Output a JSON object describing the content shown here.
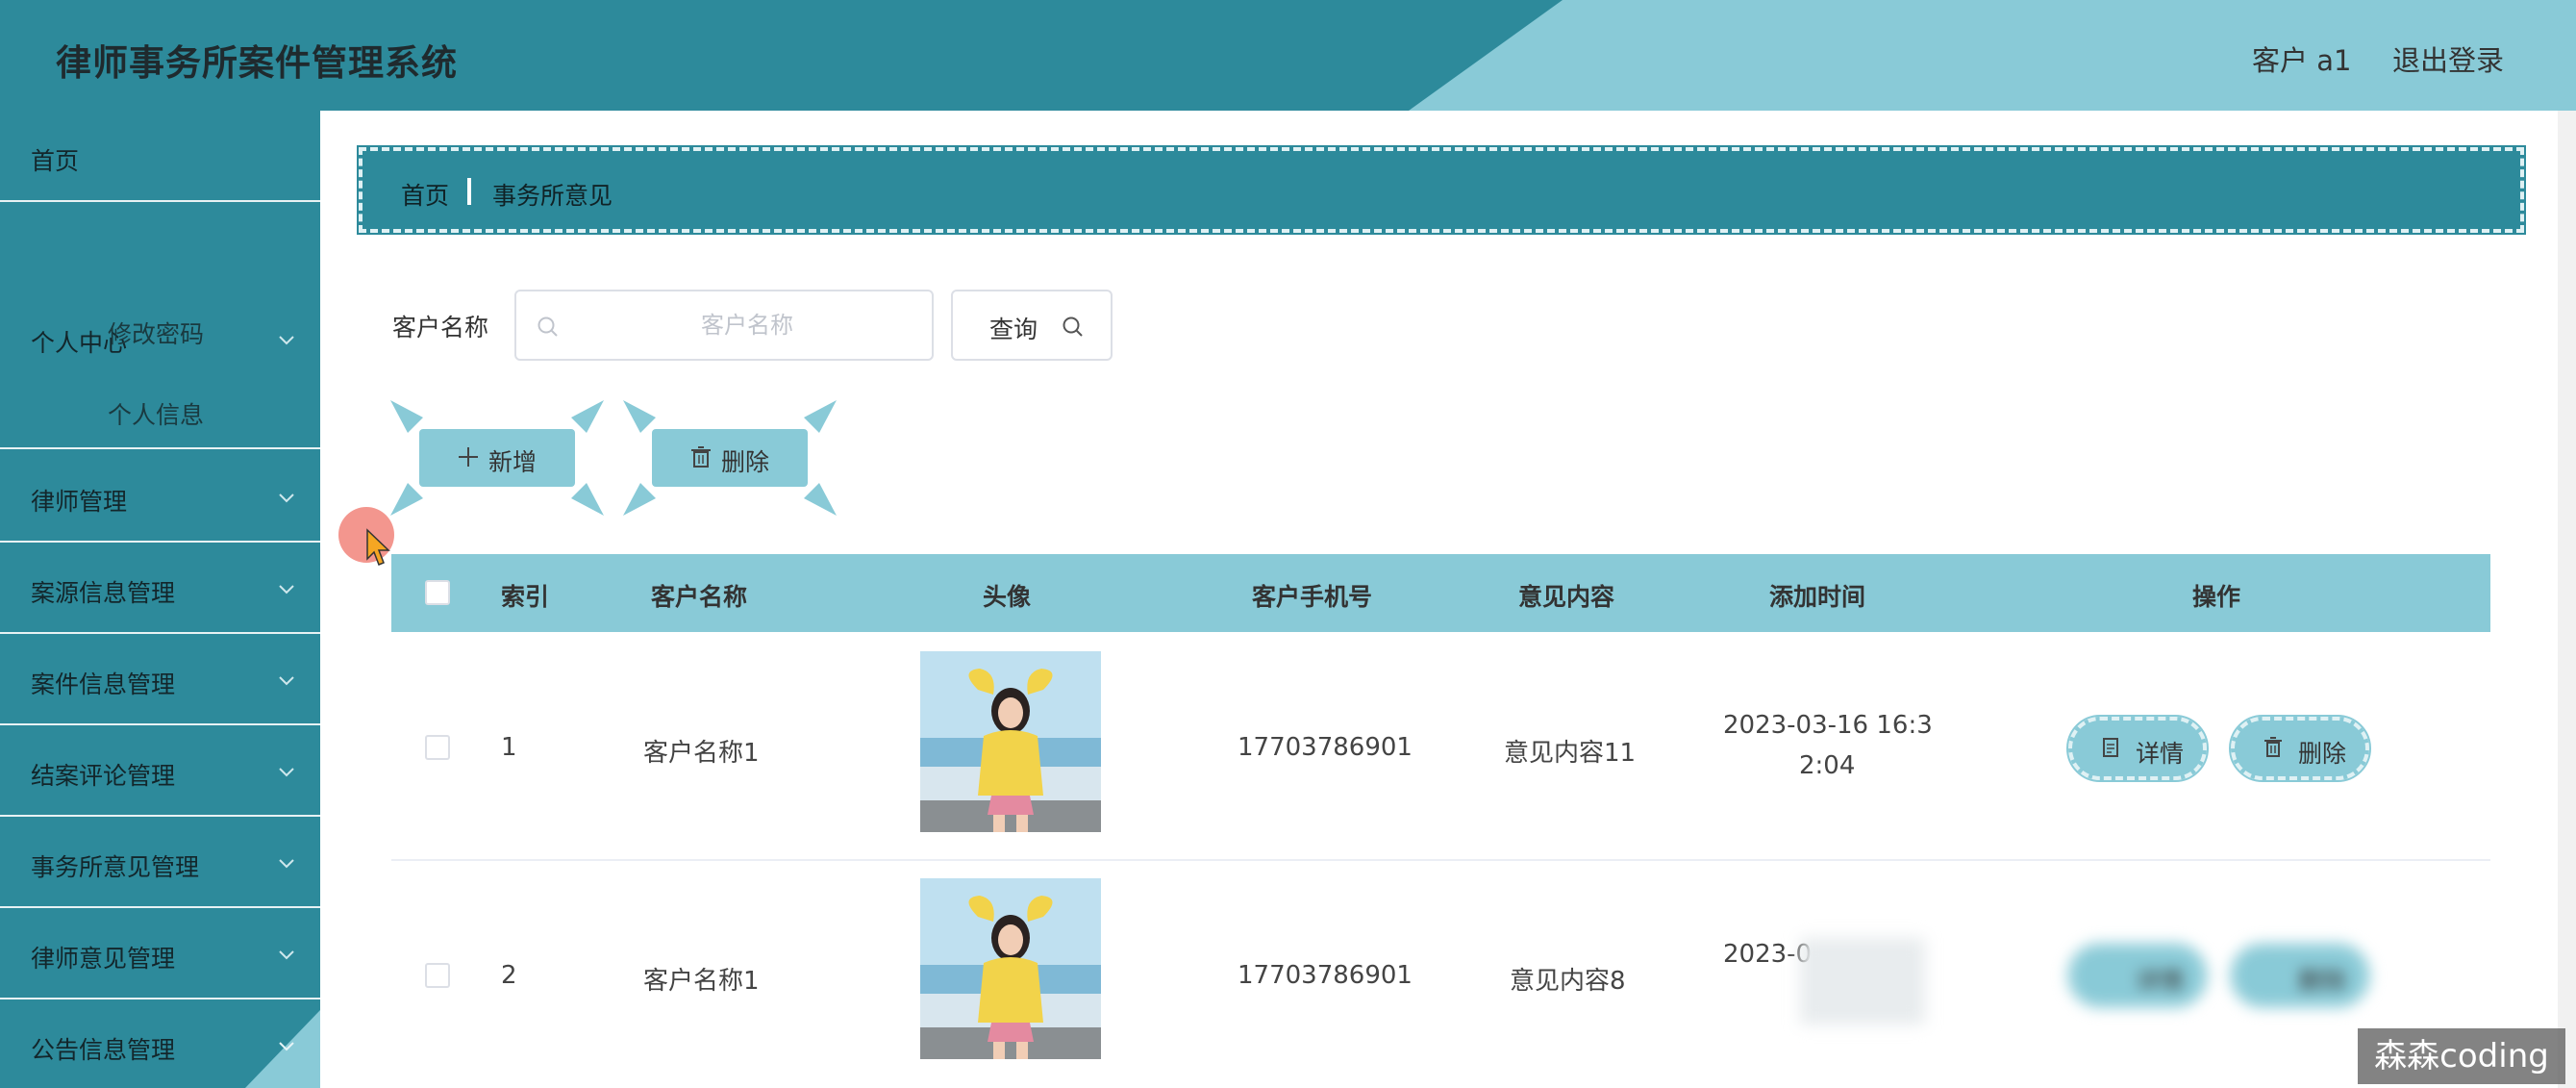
{
  "header": {
    "title": "律师事务所案件管理系统",
    "user": "客户 a1",
    "logout": "退出登录"
  },
  "sidebar": {
    "items": [
      {
        "label": "首页"
      },
      {
        "label": "个人中心"
      },
      {
        "label": "律师管理"
      },
      {
        "label": "案源信息管理"
      },
      {
        "label": "案件信息管理"
      },
      {
        "label": "结案评论管理"
      },
      {
        "label": "事务所意见管理"
      },
      {
        "label": "律师意见管理"
      },
      {
        "label": "公告信息管理"
      }
    ],
    "subitems": [
      "修改密码",
      "个人信息"
    ]
  },
  "breadcrumb": {
    "home": "首页",
    "current": "事务所意见"
  },
  "search": {
    "label": "客户名称",
    "placeholder": "客户名称",
    "button": "查询"
  },
  "actions": {
    "add": "新增",
    "delete": "删除"
  },
  "table": {
    "columns": [
      "索引",
      "客户名称",
      "头像",
      "客户手机号",
      "意见内容",
      "添加时间",
      "操作"
    ],
    "rows": [
      {
        "index": "1",
        "name": "客户名称1",
        "phone": "17703786901",
        "content": "意见内容11",
        "time_line1": "2023-03-16 16:3",
        "time_line2": "2:04",
        "detail": "详情",
        "delete": "删除"
      },
      {
        "index": "2",
        "name": "客户名称1",
        "phone": "17703786901",
        "content": "意见内容8",
        "time_line1": "2023-0",
        "time_line2": "",
        "detail": "详情",
        "delete": "删除"
      }
    ]
  },
  "watermark": "森森coding",
  "colors": {
    "primary": "#2d8a9b",
    "light": "#89cad7"
  }
}
